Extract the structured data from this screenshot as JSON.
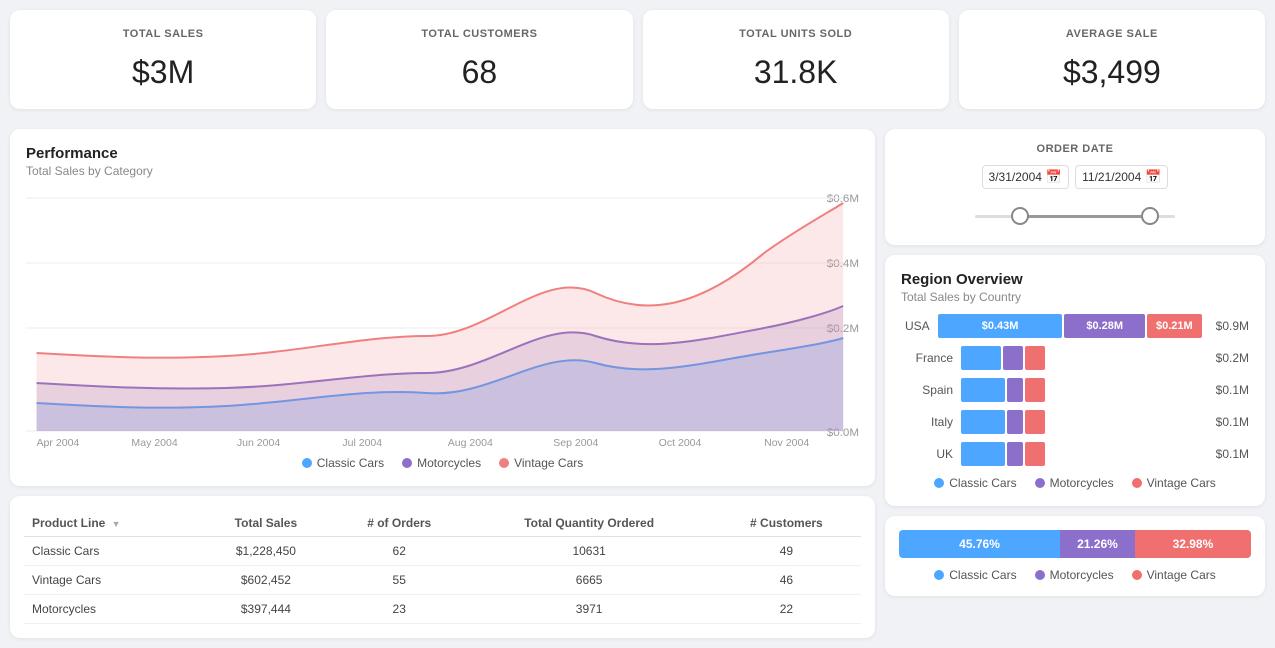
{
  "kpis": [
    {
      "label": "TOTAL SALES",
      "value": "$3M"
    },
    {
      "label": "TOTAL CUSTOMERS",
      "value": "68"
    },
    {
      "label": "TOTAL UNITS SOLD",
      "value": "31.8K"
    },
    {
      "label": "AVERAGE SALE",
      "value": "$3,499"
    }
  ],
  "orderDate": {
    "title": "ORDER DATE",
    "startDate": "3/31/2004",
    "endDate": "11/21/2004"
  },
  "performance": {
    "title": "Performance",
    "subtitle": "Total Sales by Category",
    "xLabels": [
      "Apr 2004",
      "May 2004",
      "Jun 2004",
      "Jul 2004",
      "Aug 2004",
      "Sep 2004",
      "Oct 2004",
      "Nov 2004"
    ],
    "yLabels": [
      "$0.0M",
      "$0.2M",
      "$0.4M",
      "$0.6M"
    ],
    "legend": [
      {
        "label": "Classic Cars",
        "color": "#4da6ff"
      },
      {
        "label": "Motorcycles",
        "color": "#8b6fcb"
      },
      {
        "label": "Vintage Cars",
        "color": "#f08080"
      }
    ]
  },
  "regionOverview": {
    "title": "Region Overview",
    "subtitle": "Total Sales by Country",
    "regions": [
      {
        "name": "USA",
        "bars": [
          {
            "label": "$0.43M",
            "pct": 48,
            "color": "#4da6ff"
          },
          {
            "label": "$0.28M",
            "pct": 31,
            "color": "#8b6fcb"
          },
          {
            "label": "$0.21M",
            "pct": 21,
            "color": "#f07070"
          }
        ],
        "total": "$0.9M"
      },
      {
        "name": "France",
        "bars": [
          {
            "label": "",
            "pct": 50,
            "color": "#4da6ff"
          },
          {
            "label": "",
            "pct": 25,
            "color": "#8b6fcb"
          },
          {
            "label": "",
            "pct": 25,
            "color": "#f07070"
          }
        ],
        "total": "$0.2M"
      },
      {
        "name": "Spain",
        "bars": [
          {
            "label": "",
            "pct": 55,
            "color": "#4da6ff"
          },
          {
            "label": "",
            "pct": 20,
            "color": "#8b6fcb"
          },
          {
            "label": "",
            "pct": 25,
            "color": "#f07070"
          }
        ],
        "total": "$0.1M"
      },
      {
        "name": "Italy",
        "bars": [
          {
            "label": "",
            "pct": 55,
            "color": "#4da6ff"
          },
          {
            "label": "",
            "pct": 20,
            "color": "#8b6fcb"
          },
          {
            "label": "",
            "pct": 25,
            "color": "#f07070"
          }
        ],
        "total": "$0.1M"
      },
      {
        "name": "UK",
        "bars": [
          {
            "label": "",
            "pct": 55,
            "color": "#4da6ff"
          },
          {
            "label": "",
            "pct": 20,
            "color": "#8b6fcb"
          },
          {
            "label": "",
            "pct": 25,
            "color": "#f07070"
          }
        ],
        "total": "$0.1M"
      }
    ],
    "legend": [
      {
        "label": "Classic Cars",
        "color": "#4da6ff"
      },
      {
        "label": "Motorcycles",
        "color": "#8b6fcb"
      },
      {
        "label": "Vintage Cars",
        "color": "#f07070"
      }
    ]
  },
  "bottomBar": {
    "segments": [
      {
        "label": "45.76%",
        "pct": 45.76,
        "color": "#4da6ff"
      },
      {
        "label": "21.26%",
        "pct": 21.26,
        "color": "#8b6fcb"
      },
      {
        "label": "32.98%",
        "pct": 32.98,
        "color": "#f07070"
      }
    ],
    "legend": [
      {
        "label": "Classic Cars",
        "color": "#4da6ff"
      },
      {
        "label": "Motorcycles",
        "color": "#8b6fcb"
      },
      {
        "label": "Vintage Cars",
        "color": "#f07070"
      }
    ]
  },
  "table": {
    "columns": [
      "Product Line",
      "Total Sales",
      "# of Orders",
      "Total Quantity Ordered",
      "# Customers"
    ],
    "rows": [
      [
        "Classic Cars",
        "$1,228,450",
        "62",
        "10631",
        "49"
      ],
      [
        "Vintage Cars",
        "$602,452",
        "55",
        "6665",
        "46"
      ],
      [
        "Motorcycles",
        "$397,444",
        "23",
        "3971",
        "22"
      ]
    ]
  }
}
